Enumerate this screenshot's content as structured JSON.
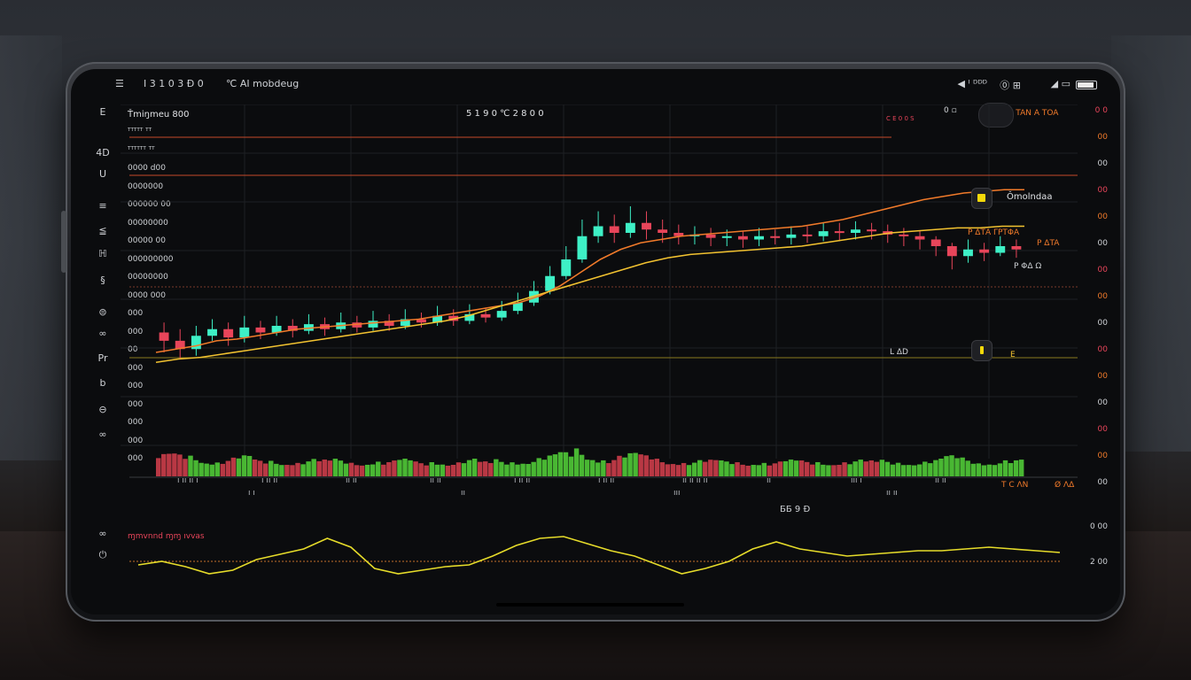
{
  "status_bar": {
    "left_time": "I 3 1 0 3 Ð 0",
    "left_app": "℃ AI  mobdeug",
    "right_signal": "◀ ᴵ ᴰᴰᴰ",
    "right_icons": "⓪ ⊞"
  },
  "chart_header": {
    "symbol": "Ťmiŋmeu  800",
    "center_value": "5 1 9 0 ℃ 2 8 0 0",
    "marker_top": "0 ▫",
    "price_right": "P TAN A TOA",
    "price_tag": "C E 0 0 S"
  },
  "sidebar": {
    "icons": [
      "E",
      "4D",
      "U",
      "≡",
      "≦",
      "ℍ",
      "§",
      "⊜",
      "∞",
      "Pr",
      "b",
      "⊖",
      "∞"
    ]
  },
  "y_labels_left": [
    "ᵀᵀᵀᵀᵀ ᵀᵀ",
    "ᵀᵀᵀᵀᵀᵀ ᵀᵀ",
    "0000  d00",
    "0000000",
    "000000 00",
    "00000000",
    "00000 00",
    "000000000",
    "00000000",
    "0000  000",
    "000",
    "000",
    "00",
    "000",
    "000",
    "000",
    "000",
    "000",
    "000"
  ],
  "y_labels_right": [
    "0 0",
    "00",
    "00",
    "00",
    "00",
    "00",
    "00",
    "00",
    "00",
    "00",
    "00",
    "00",
    "00",
    "00",
    "00"
  ],
  "annotations": {
    "overlay_label": "Ǒmolndaa",
    "mid_price_a": "P ΔTΑ ΓΡΤΦΑ",
    "mid_price_b": "P  ΔTA",
    "side_price": "P ΦΔ Ω",
    "lower_tag": "L ΔD",
    "lower_tag_right": "E",
    "bottom_right_a": "T C ΛN",
    "bottom_right_b": "Ø ΛΔ"
  },
  "x_labels": [
    "ı ıı ıı ı",
    "ı ıı ıı",
    "ıı ıı",
    "ıı ıı",
    "ı  ıı ıı",
    "ı ıı ıı",
    "ıı ıı ıı ıı",
    "ıı",
    "ııı ı",
    "ıı ıı"
  ],
  "x_sub_labels": [
    "ı ı",
    "ıı",
    "ııı",
    "ıı ıı"
  ],
  "oscillator": {
    "title": "ɱmvnnd ɱɱ ıvvas",
    "scale_label": "ƂƂ 9 Ð",
    "right_a": "0 00",
    "right_b": "2 00"
  },
  "colors": {
    "bull": "#3ef0c6",
    "bear": "#e8455a",
    "ma_orange": "#f07a2a",
    "ma_yellow": "#f2c230",
    "osc": "#e6dc2a",
    "volume_up": "#55d63a",
    "volume_down": "#d8414e"
  },
  "chart_data": {
    "type": "candlestick",
    "candles": [
      [
        60,
        55,
        66,
        48
      ],
      [
        55,
        50,
        62,
        44
      ],
      [
        50,
        58,
        64,
        46
      ],
      [
        58,
        62,
        68,
        55
      ],
      [
        62,
        57,
        66,
        52
      ],
      [
        57,
        63,
        70,
        54
      ],
      [
        63,
        60,
        67,
        56
      ],
      [
        60,
        64,
        70,
        58
      ],
      [
        64,
        61,
        68,
        57
      ],
      [
        61,
        65,
        71,
        59
      ],
      [
        65,
        62,
        69,
        58
      ],
      [
        62,
        66,
        72,
        60
      ],
      [
        66,
        63,
        70,
        60
      ],
      [
        63,
        67,
        73,
        61
      ],
      [
        67,
        64,
        71,
        61
      ],
      [
        64,
        68,
        74,
        62
      ],
      [
        68,
        66,
        72,
        63
      ],
      [
        66,
        70,
        76,
        64
      ],
      [
        70,
        67,
        74,
        64
      ],
      [
        67,
        71,
        77,
        65
      ],
      [
        71,
        69,
        75,
        66
      ],
      [
        69,
        73,
        79,
        67
      ],
      [
        73,
        78,
        84,
        71
      ],
      [
        78,
        85,
        91,
        76
      ],
      [
        85,
        94,
        100,
        83
      ],
      [
        94,
        104,
        112,
        92
      ],
      [
        104,
        118,
        128,
        102
      ],
      [
        118,
        124,
        133,
        114
      ],
      [
        124,
        120,
        131,
        114
      ],
      [
        120,
        126,
        136,
        117
      ],
      [
        126,
        122,
        133,
        116
      ],
      [
        122,
        120,
        128,
        114
      ],
      [
        120,
        118,
        125,
        113
      ],
      [
        118,
        119,
        124,
        113
      ],
      [
        119,
        117,
        123,
        112
      ],
      [
        117,
        118,
        122,
        112
      ],
      [
        118,
        116,
        121,
        111
      ],
      [
        116,
        118,
        123,
        112
      ],
      [
        118,
        117,
        122,
        113
      ],
      [
        117,
        119,
        124,
        113
      ],
      [
        119,
        118,
        124,
        114
      ],
      [
        118,
        121,
        126,
        115
      ],
      [
        121,
        120,
        126,
        115
      ],
      [
        120,
        122,
        127,
        116
      ],
      [
        122,
        121,
        126,
        116
      ],
      [
        121,
        119,
        125,
        114
      ],
      [
        119,
        118,
        123,
        112
      ],
      [
        118,
        116,
        121,
        110
      ],
      [
        116,
        112,
        118,
        106
      ],
      [
        112,
        106,
        114,
        98
      ],
      [
        106,
        110,
        116,
        102
      ],
      [
        110,
        108,
        114,
        103
      ],
      [
        108,
        112,
        118,
        106
      ],
      [
        112,
        110,
        116,
        105
      ]
    ],
    "ma_fast": [
      48,
      50,
      52,
      55,
      56,
      58,
      60,
      62,
      63,
      64,
      65,
      66,
      67,
      68,
      70,
      72,
      74,
      76,
      78,
      82,
      88,
      96,
      104,
      110,
      114,
      116,
      118,
      119,
      120,
      121,
      122,
      123,
      124,
      126,
      128,
      131,
      134,
      137,
      140,
      142,
      144,
      145,
      146,
      146
    ],
    "ma_slow": [
      42,
      44,
      45,
      47,
      49,
      51,
      53,
      55,
      57,
      59,
      61,
      63,
      65,
      67,
      70,
      74,
      78,
      82,
      86,
      90,
      94,
      98,
      102,
      105,
      107,
      108,
      109,
      110,
      111,
      112,
      114,
      116,
      118,
      120,
      121,
      122,
      123,
      123,
      124,
      124
    ],
    "oscillator": [
      40,
      44,
      38,
      30,
      34,
      46,
      52,
      58,
      70,
      60,
      36,
      30,
      34,
      38,
      40,
      50,
      62,
      70,
      72,
      64,
      56,
      50,
      40,
      30,
      36,
      44,
      58,
      66,
      58,
      54,
      50,
      52,
      54,
      56,
      56,
      58,
      60,
      58,
      56,
      54
    ],
    "ylim": [
      0,
      160
    ]
  }
}
